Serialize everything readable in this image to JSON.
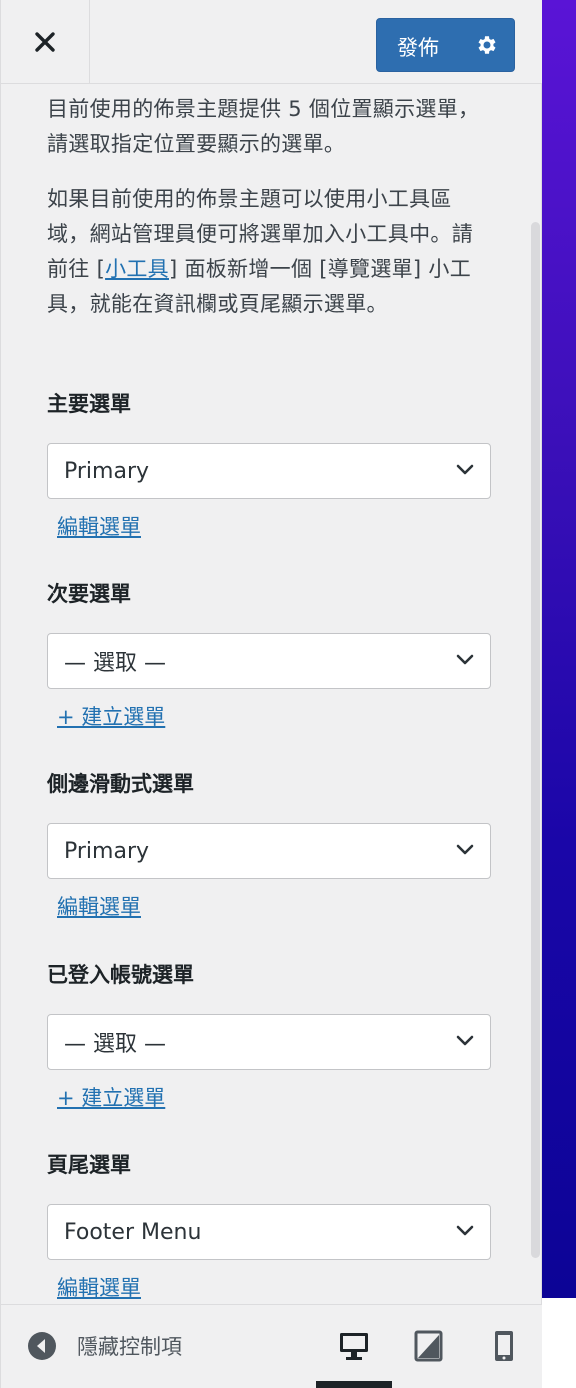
{
  "header": {
    "close_icon": "close-icon",
    "publish_label": "發佈",
    "settings_icon": "gear-icon",
    "publish_color": "#2e6eb0"
  },
  "description": {
    "paragraph1": "目前使用的佈景主題提供 5 個位置顯示選單，請選取指定位置要顯示的選單。",
    "paragraph2_before": "如果目前使用的佈景主題可以使用小工具區域，網站管理員便可將選單加入小工具中。請前往 [",
    "paragraph2_link": "小工具",
    "paragraph2_after": "] 面板新增一個 [導覽選單] 小工具，就能在資訊欄或頁尾顯示選單。"
  },
  "locations": [
    {
      "title": "主要選單",
      "selected": "Primary",
      "link": "編輯選單"
    },
    {
      "title": "次要選單",
      "selected": "— 選取 —",
      "link": "+ 建立選單"
    },
    {
      "title": "側邊滑動式選單",
      "selected": "Primary",
      "link": "編輯選單"
    },
    {
      "title": "已登入帳號選單",
      "selected": "— 選取 —",
      "link": "+ 建立選單"
    },
    {
      "title": "頁尾選單",
      "selected": "Footer Menu",
      "link": "編輯選單"
    }
  ],
  "footer": {
    "hide_label": "隱藏控制項",
    "hide_icon": "arrow-left-circle-icon",
    "devices": [
      "desktop-icon",
      "tablet-icon",
      "mobile-icon"
    ],
    "active_device": "desktop"
  }
}
